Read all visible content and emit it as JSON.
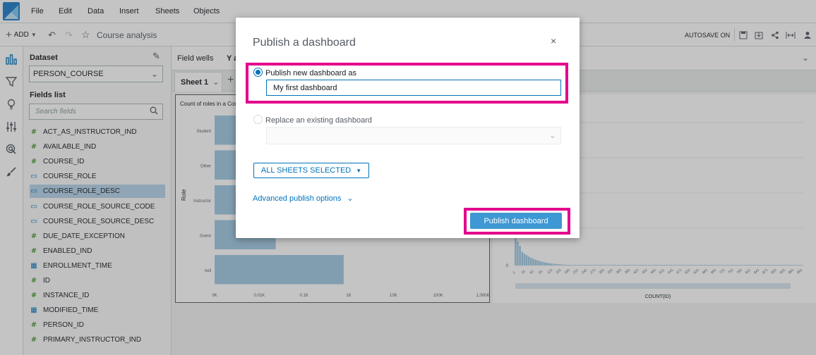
{
  "menu": [
    "File",
    "Edit",
    "Data",
    "Insert",
    "Sheets",
    "Objects"
  ],
  "toolbar": {
    "add_label": "ADD",
    "analysis_name": "Course analysis",
    "autosave_label": "AUTOSAVE ON"
  },
  "dataset": {
    "heading": "Dataset",
    "selected": "PERSON_COURSE",
    "fields_heading": "Fields list",
    "search_placeholder": "Search fields"
  },
  "fields": [
    {
      "icon": "#",
      "name": "ACT_AS_INSTRUCTOR_IND"
    },
    {
      "icon": "#",
      "name": "AVAILABLE_IND"
    },
    {
      "icon": "#",
      "name": "COURSE_ID"
    },
    {
      "icon": "▭",
      "name": "COURSE_ROLE"
    },
    {
      "icon": "▭",
      "name": "COURSE_ROLE_DESC"
    },
    {
      "icon": "▭",
      "name": "COURSE_ROLE_SOURCE_CODE"
    },
    {
      "icon": "▭",
      "name": "COURSE_ROLE_SOURCE_DESC"
    },
    {
      "icon": "#",
      "name": "DUE_DATE_EXCEPTION"
    },
    {
      "icon": "#",
      "name": "ENABLED_IND"
    },
    {
      "icon": "▦",
      "name": "ENROLLMENT_TIME"
    },
    {
      "icon": "#",
      "name": "ID"
    },
    {
      "icon": "#",
      "name": "INSTANCE_ID"
    },
    {
      "icon": "▦",
      "name": "MODIFIED_TIME"
    },
    {
      "icon": "#",
      "name": "PERSON_ID"
    },
    {
      "icon": "#",
      "name": "PRIMARY_INSTRUCTOR_IND"
    }
  ],
  "workspace": {
    "field_wells_label": "Field wells",
    "field_wells_extra": "Y a",
    "sheet_tab": "Sheet 1",
    "visual1_title": "Count of roles in a Cou",
    "visual2_xlabel": "COUNT(ID)"
  },
  "chart_data": [
    {
      "type": "bar",
      "title": "Count of roles in a Cou",
      "ylabel": "Role",
      "categories": [
        "Student",
        "Other",
        "Instructor",
        "Guest",
        "null"
      ],
      "values": [
        0.9,
        1.1,
        1.05,
        0.45,
        0.95
      ],
      "xticks": [
        "0K",
        "0.01K",
        "0.1K",
        "1K",
        "10K",
        "100K",
        "1,000K"
      ]
    },
    {
      "type": "bar",
      "xlabel": "COUNT(ID)",
      "xticks": [
        "1",
        "31",
        "61",
        "91",
        "121",
        "151",
        "181",
        "211",
        "241",
        "271",
        "301",
        "331",
        "361",
        "391",
        "421",
        "451",
        "481",
        "511",
        "541",
        "571",
        "601",
        "631",
        "661",
        "691",
        "721",
        "751",
        "781",
        "811",
        "841",
        "871",
        "901",
        "931",
        "961",
        "991"
      ],
      "yticks": [
        "0"
      ]
    }
  ],
  "dialog": {
    "title": "Publish a dashboard",
    "option_new_label": "Publish new dashboard as",
    "new_name_value": "My first dashboard",
    "option_replace_label": "Replace an existing dashboard",
    "sheets_button": "ALL SHEETS SELECTED",
    "advanced_link": "Advanced publish options",
    "publish_button": "Publish dashboard"
  },
  "colors": {
    "highlight": "#e4008c",
    "primary_button": "#3d98d3",
    "link": "#0073bb"
  }
}
